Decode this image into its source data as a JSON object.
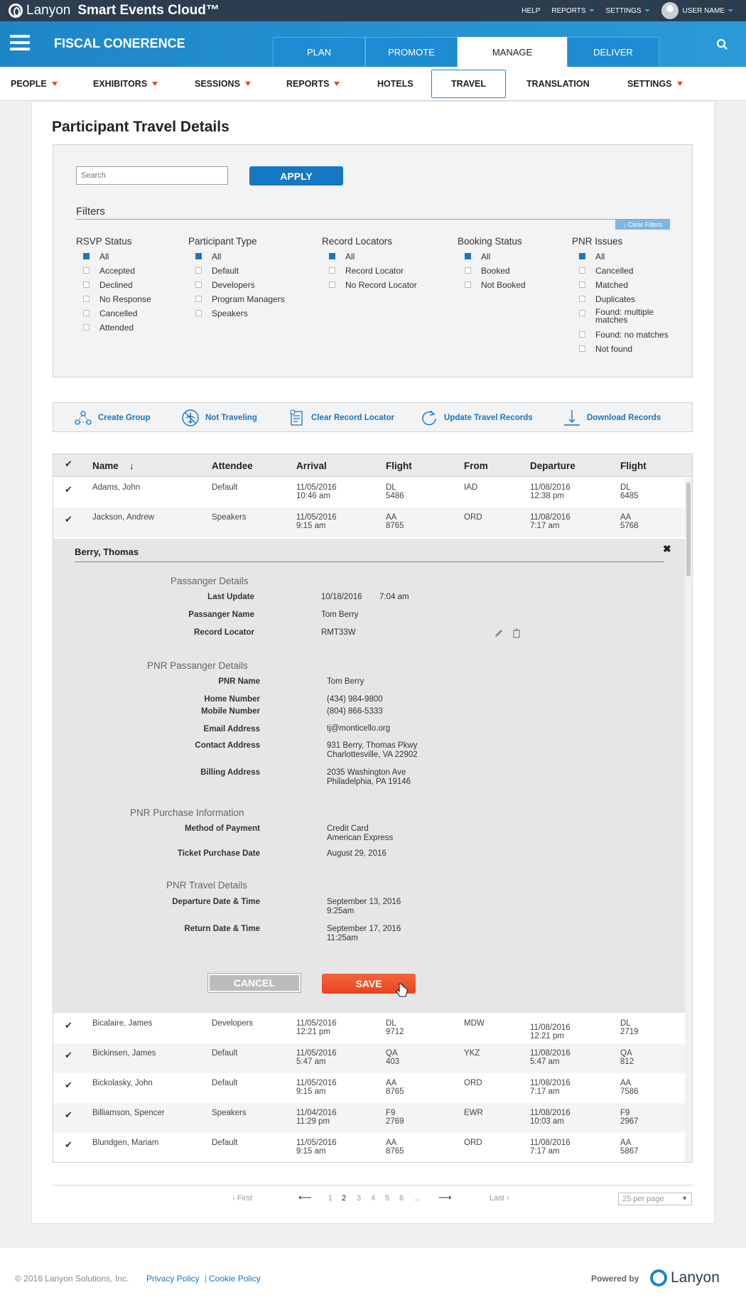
{
  "topbar": {
    "brand_logo": "Lanyon",
    "brand_product": "Smart Events Cloud™",
    "links": [
      "HELP",
      "REPORTS",
      "SETTINGS"
    ],
    "user": "USER NAME"
  },
  "header": {
    "event_title": "FISCAL CONERENCE",
    "tabs": [
      "PLAN",
      "PROMOTE",
      "MANAGE",
      "DELIVER"
    ],
    "active_tab": "MANAGE"
  },
  "subnav": [
    "PEOPLE",
    "EXHIBITORS",
    "SESSIONS",
    "REPORTS",
    "HOTELS",
    "TRAVEL",
    "TRANSLATION",
    "SETTINGS"
  ],
  "page_title": "Participant Travel Details",
  "search": {
    "placeholder": "Search",
    "apply": "APPLY"
  },
  "filters": {
    "label": "Filters",
    "clear": "↓ Clear Filters",
    "rsvp": {
      "title": "RSVP Status",
      "items": [
        "All",
        "Accepted",
        "Declined",
        "No Response",
        "Cancelled",
        "Attended"
      ]
    },
    "ptype": {
      "title": "Participant Type",
      "items": [
        "All",
        "Default",
        "Developers",
        "Program Managers",
        "Speakers"
      ]
    },
    "rloc": {
      "title": "Record Locators",
      "items": [
        "All",
        "Record Locator",
        "No Record Locator"
      ]
    },
    "booking": {
      "title": "Booking Status",
      "items": [
        "All",
        "Booked",
        "Not Booked"
      ]
    },
    "pnr": {
      "title": "PNR Issues",
      "items": [
        "All",
        "Cancelled",
        "Matched",
        "Duplicates",
        "Found: multiple matches",
        "Found: no matches",
        "Not found"
      ]
    }
  },
  "actions": [
    "Create Group",
    "Not Traveling",
    "Clear Record Locator",
    "Update Travel Records",
    "Download Records"
  ],
  "table": {
    "headers": [
      "Name",
      "Attendee",
      "Arrival",
      "Flight",
      "From",
      "Departure",
      "Flight"
    ],
    "rows_top": [
      {
        "name": "Adams, John",
        "attendee": "Default",
        "arrival": [
          "11/05/2016",
          "10:46 am"
        ],
        "flight": [
          "DL",
          "5486"
        ],
        "from": "IAD",
        "departure": [
          "11/08/2016",
          "12:38 pm"
        ],
        "flight2": [
          "DL",
          "6485"
        ]
      },
      {
        "name": "Jackson, Andrew",
        "attendee": "Speakers",
        "arrival": [
          "11/05/2016",
          "9:15 am"
        ],
        "flight": [
          "AA",
          "8765"
        ],
        "from": "ORD",
        "departure": [
          "11/08/2016",
          "7:17 am"
        ],
        "flight2": [
          "AA",
          "5768"
        ]
      }
    ],
    "rows_bottom": [
      {
        "name": "Bicalaire, James",
        "attendee": "Developers",
        "arrival": [
          "11/05/2016",
          "12:21 pm"
        ],
        "flight": [
          "DL",
          "9712"
        ],
        "from": "MDW",
        "departure": [
          "11/08/2016",
          "12:21 pm"
        ],
        "flight2": [
          "DL",
          "2719"
        ]
      },
      {
        "name": "Bickinsen, James",
        "attendee": "Default",
        "arrival": [
          "11/05/2016",
          "5:47 am"
        ],
        "flight": [
          "QA",
          "403"
        ],
        "from": "YKZ",
        "departure": [
          "11/08/2016",
          "5:47 am"
        ],
        "flight2": [
          "QA",
          "812"
        ]
      },
      {
        "name": "Bickolasky, John",
        "attendee": "Default",
        "arrival": [
          "11/05/2016",
          "9:15 am"
        ],
        "flight": [
          "AA",
          "8765"
        ],
        "from": "ORD",
        "departure": [
          "11/08/2016",
          "7:17 am"
        ],
        "flight2": [
          "AA",
          "7586"
        ]
      },
      {
        "name": "Billiamson, Spencer",
        "attendee": "Speakers",
        "arrival": [
          "11/04/2016",
          "11:29 pm"
        ],
        "flight": [
          "F9",
          "2769"
        ],
        "from": "EWR",
        "departure": [
          "11/08/2016",
          "10:03 am"
        ],
        "flight2": [
          "F9",
          "2967"
        ]
      },
      {
        "name": "Blundgen, Mariam",
        "attendee": "Default",
        "arrival": [
          "11/05/2016",
          "9:15 am"
        ],
        "flight": [
          "AA",
          "8765"
        ],
        "from": "ORD",
        "departure": [
          "11/08/2016",
          "7:17 am"
        ],
        "flight2": [
          "AA",
          "5867"
        ]
      }
    ]
  },
  "detail": {
    "name": "Berry, Thomas",
    "pd": {
      "title": "Passanger Details",
      "last_update_label": "Last Update",
      "last_update_date": "10/18/2016",
      "last_update_time": "7:04 am",
      "name_label": "Passanger Name",
      "name": "Tom Berry",
      "loc_label": "Record Locator",
      "loc": "RMT33W"
    },
    "pnr": {
      "title": "PNR Passanger Details",
      "name_label": "PNR Name",
      "name": "Tom Berry",
      "home_label": "Home Number",
      "home": "(434) 984-9800",
      "mobile_label": "Mobile Number",
      "mobile": "(804) 866-5333",
      "email_label": "Email Address",
      "email": "tj@monticello.org",
      "contact_label": "Contact Address",
      "contact1": "931 Berry, Thomas Pkwy",
      "contact2": "Charlottesville, VA 22902",
      "billing_label": "Billing Address",
      "billing1": "2035 Washington Ave",
      "billing2": "Philadelphia, PA 19146"
    },
    "purchase": {
      "title": "PNR Purchase Information",
      "method_label": "Method of Payment",
      "method1": "Credit Card",
      "method2": "American Express",
      "date_label": "Ticket Purchase Date",
      "date": "August 29, 2016"
    },
    "travel": {
      "title": "PNR Travel Details",
      "dep_label": "Departure Date & Time",
      "dep1": "September 13, 2016",
      "dep2": "9:25am",
      "ret_label": "Return Date & Time",
      "ret1": "September 17, 2016",
      "ret2": "11:25am"
    },
    "cancel": "CANCEL",
    "save": "SAVE"
  },
  "pagination": {
    "first": "‹ First",
    "prev": "⟵",
    "pages": [
      "1",
      "2",
      "3",
      "4",
      "5",
      "6",
      "..."
    ],
    "next": "⟶",
    "last": "Last ›",
    "per_page": "25 per page"
  },
  "footer": {
    "copyright": "© 2016 Lanyon Solutions, Inc.",
    "privacy": "Privacy Policy",
    "sep": "|",
    "cookie": "Cookie Policy",
    "powered": "Powered by",
    "logo": "Lanyon"
  }
}
